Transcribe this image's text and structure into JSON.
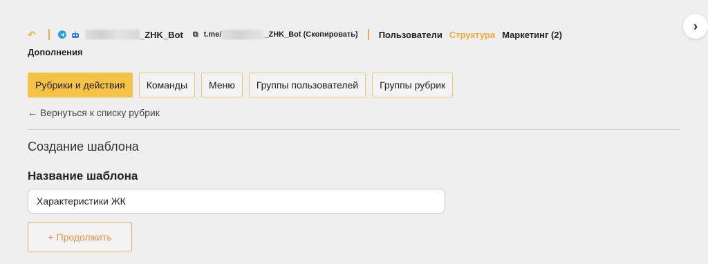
{
  "header": {
    "bot_name_suffix": "_ZHK_Bot",
    "link_prefix": "t.me/",
    "link_suffix": "_ZHK_Bot (Скопировать)",
    "nav": [
      {
        "label": "Пользователи",
        "active": false
      },
      {
        "label": "Структура",
        "active": true
      },
      {
        "label": "Маркетинг (2)",
        "active": false
      }
    ],
    "nav_extra": "Дополнения",
    "accent_color": "#f2a93b"
  },
  "tabs": [
    {
      "label": "Рубрики и действия",
      "active": true
    },
    {
      "label": "Команды",
      "active": false
    },
    {
      "label": "Меню",
      "active": false
    },
    {
      "label": "Группы пользователей",
      "active": false
    },
    {
      "label": "Группы рубрик",
      "active": false
    }
  ],
  "back_link": "← Вернуться к списку рубрик",
  "section_title": "Создание шаблона",
  "form": {
    "name_label": "Название шаблона",
    "name_value": "Характеристики ЖК",
    "continue_label": "+ Продолжить"
  },
  "icons": [
    "back-arrow-icon",
    "telegram-icon",
    "bot-icon",
    "link-icon",
    "chevron-right-icon"
  ]
}
